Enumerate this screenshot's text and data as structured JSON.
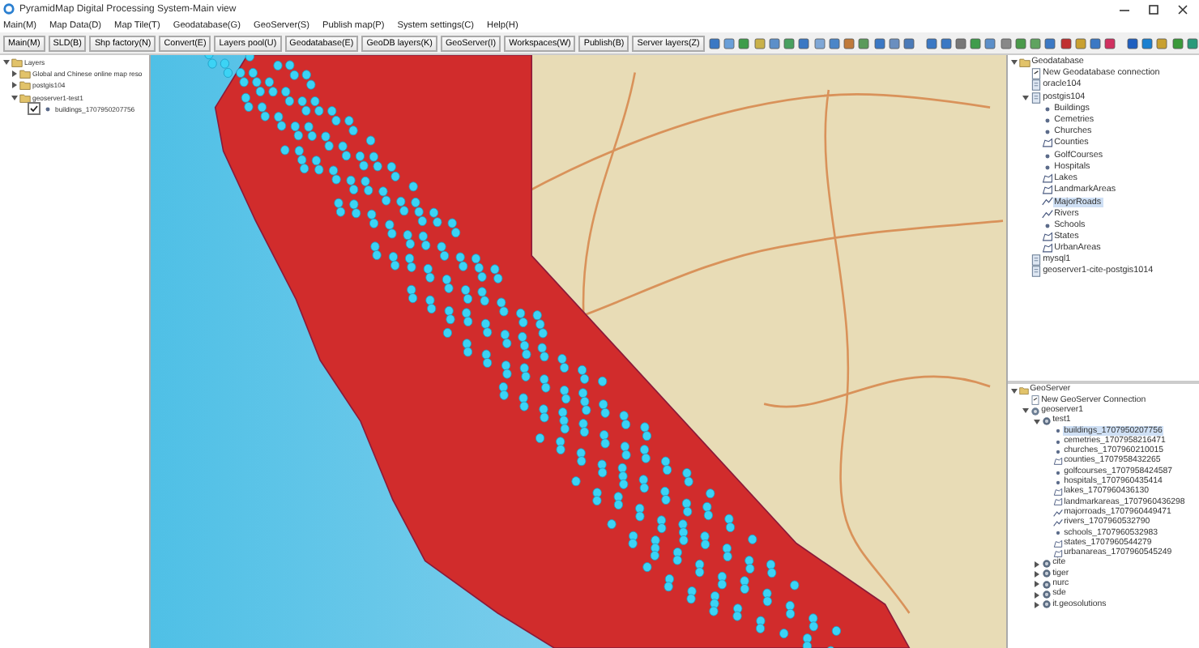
{
  "window": {
    "title": "PyramidMap Digital Processing System-Main view"
  },
  "menu": [
    "Main(M)",
    "Map Data(D)",
    "Map Tile(T)",
    "Geodatabase(G)",
    "GeoServer(S)",
    "Publish map(P)",
    "System settings(C)",
    "Help(H)"
  ],
  "toolbar": [
    "Main(M)",
    "SLD(B)",
    "Shp factory(N)",
    "Convert(E)",
    "Layers pool(U)",
    "Geodatabase(E)",
    "GeoDB layers(K)",
    "GeoServer(I)",
    "Workspaces(W)",
    "Publish(B)",
    "Server layers(Z)"
  ],
  "layers_tree": [
    {
      "label": "Layers",
      "kind": "folder",
      "expanded": true,
      "children": [
        {
          "label": "Global and Chinese online map reso",
          "kind": "folder",
          "expanded": false
        },
        {
          "label": "postgis104",
          "kind": "folder",
          "expanded": false
        },
        {
          "label": "geoserver1-test1",
          "kind": "folder",
          "expanded": true,
          "children": [
            {
              "label": "buildings_1707950207756",
              "kind": "point",
              "checked": true
            }
          ]
        }
      ]
    }
  ],
  "geodatabase_tree": [
    {
      "label": "Geodatabase",
      "kind": "folder",
      "expanded": true,
      "children": [
        {
          "label": "New Geodatabase connection",
          "kind": "new"
        },
        {
          "label": "oracle104",
          "kind": "db"
        },
        {
          "label": "postgis104",
          "kind": "db",
          "expanded": true,
          "children": [
            {
              "label": "Buildings",
              "kind": "point",
              "selected": false
            },
            {
              "label": "Cemetries",
              "kind": "point",
              "selected": false
            },
            {
              "label": "Churches",
              "kind": "point",
              "selected": false
            },
            {
              "label": "Counties",
              "kind": "polygon",
              "selected": false
            },
            {
              "label": "GolfCourses",
              "kind": "point",
              "selected": false
            },
            {
              "label": "Hospitals",
              "kind": "point",
              "selected": false
            },
            {
              "label": "Lakes",
              "kind": "polygon",
              "selected": false
            },
            {
              "label": "LandmarkAreas",
              "kind": "polygon",
              "selected": false
            },
            {
              "label": "MajorRoads",
              "kind": "line",
              "selected": true
            },
            {
              "label": "Rivers",
              "kind": "line",
              "selected": false
            },
            {
              "label": "Schools",
              "kind": "point",
              "selected": false
            },
            {
              "label": "States",
              "kind": "polygon",
              "selected": false
            },
            {
              "label": "UrbanAreas",
              "kind": "polygon",
              "selected": false
            }
          ]
        },
        {
          "label": "mysql1",
          "kind": "db"
        },
        {
          "label": "geoserver1-cite-postgis1014",
          "kind": "db"
        }
      ]
    }
  ],
  "geoserver_tree": [
    {
      "label": "GeoServer",
      "kind": "folder",
      "expanded": true,
      "children": [
        {
          "label": "New GeoServer Connection",
          "kind": "new"
        },
        {
          "label": "geoserver1",
          "kind": "server",
          "expanded": true,
          "children": [
            {
              "label": "test1",
              "kind": "workspace",
              "expanded": true,
              "children": [
                {
                  "label": "buildings_1707950207756",
                  "kind": "point",
                  "selected": true
                },
                {
                  "label": "cemetries_1707958216471",
                  "kind": "point",
                  "selected": false
                },
                {
                  "label": "churches_1707960210015",
                  "kind": "point",
                  "selected": false
                },
                {
                  "label": "counties_1707958432265",
                  "kind": "polygon",
                  "selected": false
                },
                {
                  "label": "golfcourses_1707958424587",
                  "kind": "point",
                  "selected": false
                },
                {
                  "label": "hospitals_1707960435414",
                  "kind": "point",
                  "selected": false
                },
                {
                  "label": "lakes_1707960436130",
                  "kind": "polygon",
                  "selected": false
                },
                {
                  "label": "landmarkareas_1707960436298",
                  "kind": "polygon",
                  "selected": false
                },
                {
                  "label": "majorroads_1707960449471",
                  "kind": "line",
                  "selected": false
                },
                {
                  "label": "rivers_1707960532790",
                  "kind": "line",
                  "selected": false
                },
                {
                  "label": "schools_1707960532983",
                  "kind": "point",
                  "selected": false
                },
                {
                  "label": "states_1707960544279",
                  "kind": "polygon",
                  "selected": false
                },
                {
                  "label": "urbanareas_1707960545249",
                  "kind": "polygon",
                  "selected": false
                }
              ]
            },
            {
              "label": "cite",
              "kind": "workspace",
              "expanded": false
            },
            {
              "label": "tiger",
              "kind": "workspace",
              "expanded": false
            },
            {
              "label": "nurc",
              "kind": "workspace",
              "expanded": false
            },
            {
              "label": "sde",
              "kind": "workspace",
              "expanded": false
            },
            {
              "label": "it.geosolutions",
              "kind": "workspace",
              "expanded": false
            }
          ]
        }
      ]
    }
  ]
}
